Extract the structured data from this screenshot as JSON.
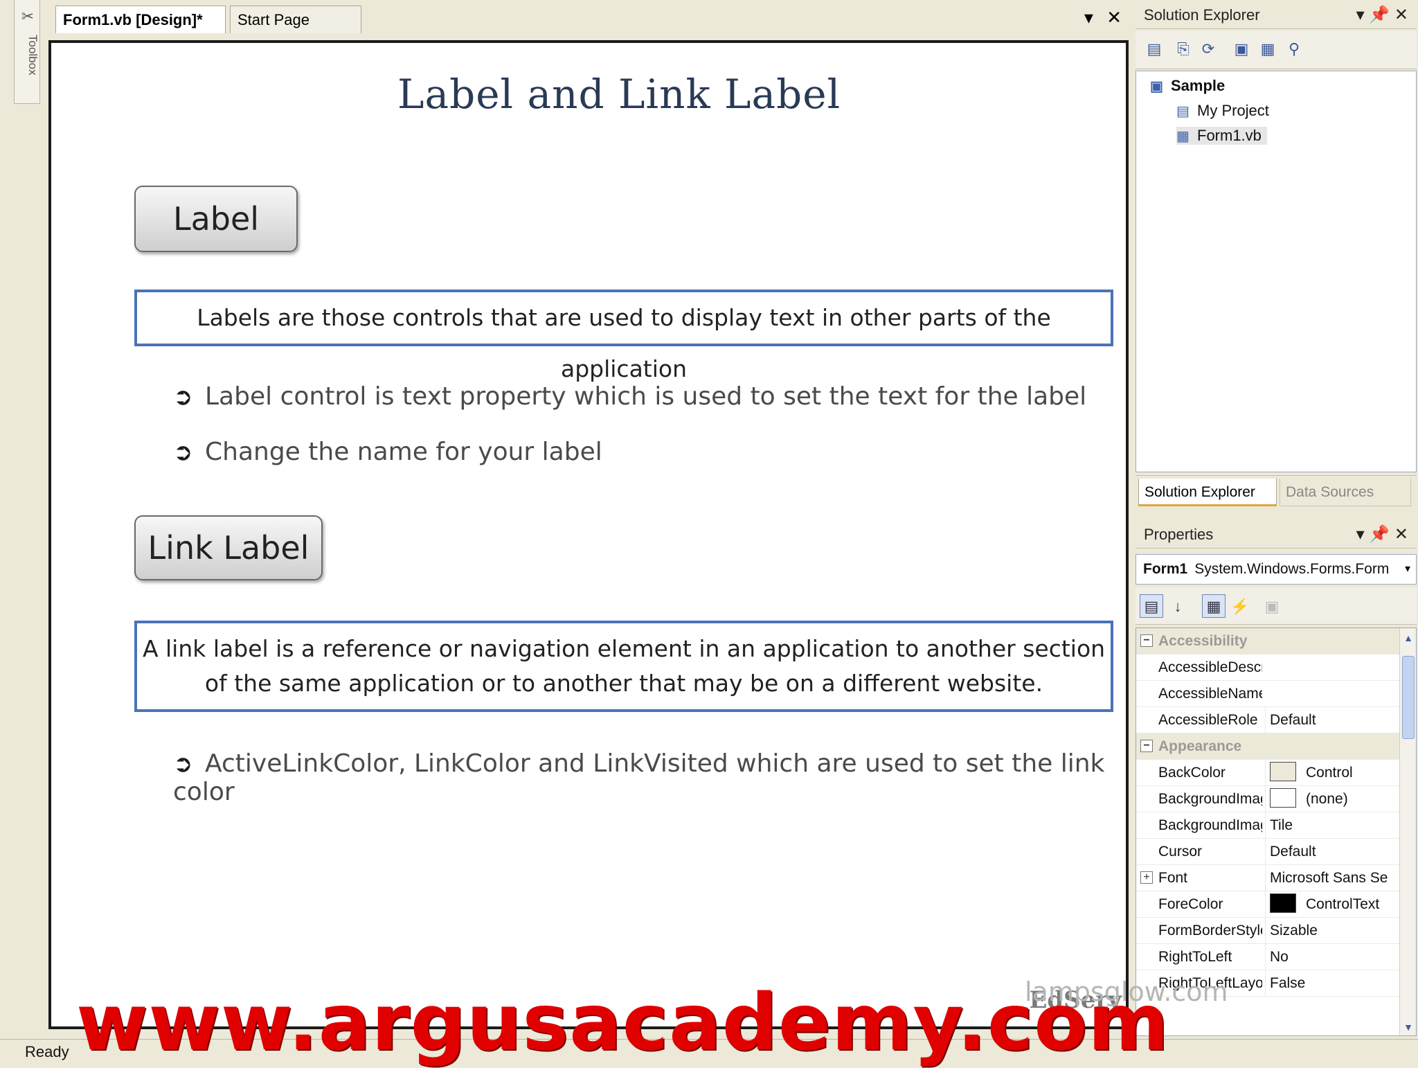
{
  "toolbox": {
    "label": "Toolbox",
    "icon": "toolbox-icon"
  },
  "document": {
    "tabs": [
      {
        "label": "Form1.vb [Design]*",
        "active": true
      },
      {
        "label": "Start Page",
        "active": false
      }
    ],
    "controls": {
      "dropdown": "▾",
      "close": "✕"
    }
  },
  "slide": {
    "title": "Label and Link Label",
    "label_button": "Label",
    "label_definition": "Labels are those controls that are used to display text in other parts of the application",
    "label_bullets": [
      "Label control is text property which is used to set the text for the label",
      "Change the name for your label"
    ],
    "link_button": "Link Label",
    "link_definition": "A link label is a reference or navigation element in an application to another section of the same application or to another that may be on a different website.",
    "link_bullets": [
      "ActiveLinkColor, LinkColor and LinkVisited which are used to set the link color"
    ],
    "logo_text": "EdServ",
    "lamp_text": "lampsglow.com"
  },
  "solution_explorer": {
    "title": "Solution Explorer",
    "tree": [
      {
        "label": "Sample",
        "icon": "solution-icon"
      },
      {
        "label": "My Project",
        "icon": "project-icon"
      },
      {
        "label": "Form1.vb",
        "icon": "form-file-icon"
      }
    ],
    "dock_tabs": [
      "Solution Explorer",
      "Data Sources"
    ]
  },
  "properties": {
    "title": "Properties",
    "object_name": "Form1",
    "object_type": "System.Windows.Forms.Form",
    "rows": [
      {
        "kind": "category",
        "name": "Accessibility",
        "sign": "⊟"
      },
      {
        "kind": "prop",
        "name": "AccessibleDescri",
        "value": ""
      },
      {
        "kind": "prop",
        "name": "AccessibleName",
        "value": ""
      },
      {
        "kind": "prop",
        "name": "AccessibleRole",
        "value": "Default"
      },
      {
        "kind": "category",
        "name": "Appearance",
        "sign": "⊟"
      },
      {
        "kind": "prop",
        "name": "BackColor",
        "value": "Control",
        "swatch": "#ece9d8"
      },
      {
        "kind": "prop",
        "name": "BackgroundImag",
        "value": "(none)",
        "swatch": "#ffffff"
      },
      {
        "kind": "prop",
        "name": "BackgroundImag",
        "value": "Tile"
      },
      {
        "kind": "prop",
        "name": "Cursor",
        "value": "Default"
      },
      {
        "kind": "prop",
        "name": "Font",
        "value": "Microsoft Sans Se",
        "sign": "⊞"
      },
      {
        "kind": "prop",
        "name": "ForeColor",
        "value": "ControlText",
        "swatch": "#000000"
      },
      {
        "kind": "prop",
        "name": "FormBorderStyle",
        "value": "Sizable"
      },
      {
        "kind": "prop",
        "name": "RightToLeft",
        "value": "No"
      },
      {
        "kind": "prop",
        "name": "RightToLeftLayo",
        "value": "False"
      }
    ]
  },
  "status": {
    "text": "Ready"
  },
  "watermark": {
    "text": "www.argusacademy.com"
  },
  "colors": {
    "title": "#293a56",
    "definition_border": "#4a73b8",
    "watermark": "#e00000"
  }
}
